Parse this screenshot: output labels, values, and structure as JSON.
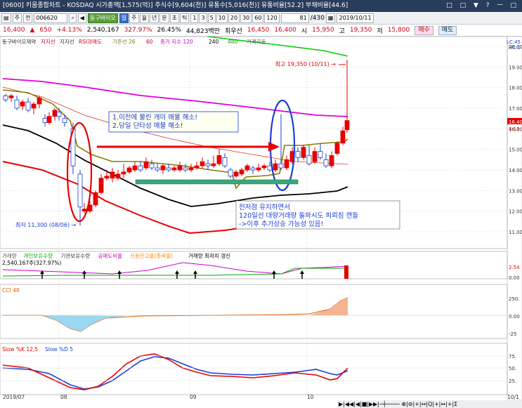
{
  "window": {
    "title": "[0600] 키움종합차트 - KOSDAQ 시가총액[1,575(억)] 주식수[9,604(천)] 유통수[5,016(천)] 유통비율[52.2] 부채비율[44.6]",
    "controls": "□ □ ▼ ? ㅡ □"
  },
  "toolbar": {
    "menu_label": "주",
    "type_label": "전",
    "code": "006620",
    "stock_name": "동구바이오",
    "period_tabs": [
      "일",
      "주",
      "월",
      "년",
      "분",
      "초",
      "틱"
    ],
    "interval_buttons": [
      "1",
      "3",
      "5",
      "10",
      "20",
      "30",
      "60",
      "120"
    ],
    "counter": "81",
    "total": "/430",
    "date": "2019/10/11"
  },
  "price_info": {
    "price": "16,400",
    "change_symbol": "▲",
    "change": "650",
    "change_pct": "+4.13%",
    "volume": "2,540,167",
    "volume_ratio": "327.97%",
    "turnover": "26.45%",
    "trade_value": "44,823백만",
    "best_bid_label": "최우선",
    "best_bid": "16,450",
    "best_ask": "16,400",
    "open_label": "시",
    "open": "15,950",
    "high_label": "고",
    "high": "19,350",
    "low_label": "저",
    "low": "15,800",
    "buy_button": "매수",
    "sell_button": "매도"
  },
  "main_chart": {
    "legend": [
      "동구바이오제약",
      "지지선",
      "지지선",
      "RSI과매도",
      "기준선 26",
      "60",
      "종가 지수 120",
      "240",
      "480",
      "가격곡동"
    ],
    "legend_colors": [
      "#2a2a2a",
      "#d4001a",
      "#333333",
      "#d4001a",
      "#8a7a00",
      "#d4001a",
      "#cc00cc",
      "#000000",
      "#00aa00",
      "#555555"
    ],
    "lc_label": "LC:45",
    "hc_label": "HC:1",
    "high_annotation": "최고 19,350 (10/11) →",
    "low_annotation": "최저 11,300 (08/06) →",
    "note_box_1": [
      "1.이전에 물린 개미 매물 해소!",
      "2.당일 단타성 매물 해소!"
    ],
    "note_box_2": [
      "전저점 유지하면서",
      "120일선 대량거래량 돌파시도 피뢰침 캔들",
      "->이후 추가상승 가능성 있음!"
    ],
    "current_price_tag": "16,40",
    "current_pct_tag": "4.13"
  },
  "price_axis": [
    "20.00",
    "19.00",
    "18.00",
    "17.00",
    "16.00",
    "15.00",
    "14.00",
    "13.00",
    "12.00",
    "11.00"
  ],
  "volume_panel": {
    "legend": [
      "거래량",
      "개인보유수량",
      "기관보유수량",
      "공매도비율",
      "신용잔고율(종목별)",
      "거래량 최저치 갱신"
    ],
    "legend_colors": [
      "#555555",
      "#00aa00",
      "#333333",
      "#cc00cc",
      "#ff8800",
      "#000000"
    ],
    "value": "2,540,167주(327.97%)",
    "axis": [
      "2.54",
      "0.00"
    ]
  },
  "cci_panel": {
    "legend": "CCI 48",
    "axis": [
      "250.",
      "0.00",
      "-25"
    ]
  },
  "slow_panel": {
    "legend_k": "Slow %K 12,5",
    "legend_d": "Slow %D 5",
    "axis": [
      "75.",
      "50.",
      "25."
    ]
  },
  "date_axis": [
    "2019/07",
    "08",
    "09",
    "10",
    "10/1"
  ],
  "navigation": "▶|◀◀|◀|■|▶▶|─┼──── ⊕|⊖|+|↔|Q|+|↔|+|Σ"
}
